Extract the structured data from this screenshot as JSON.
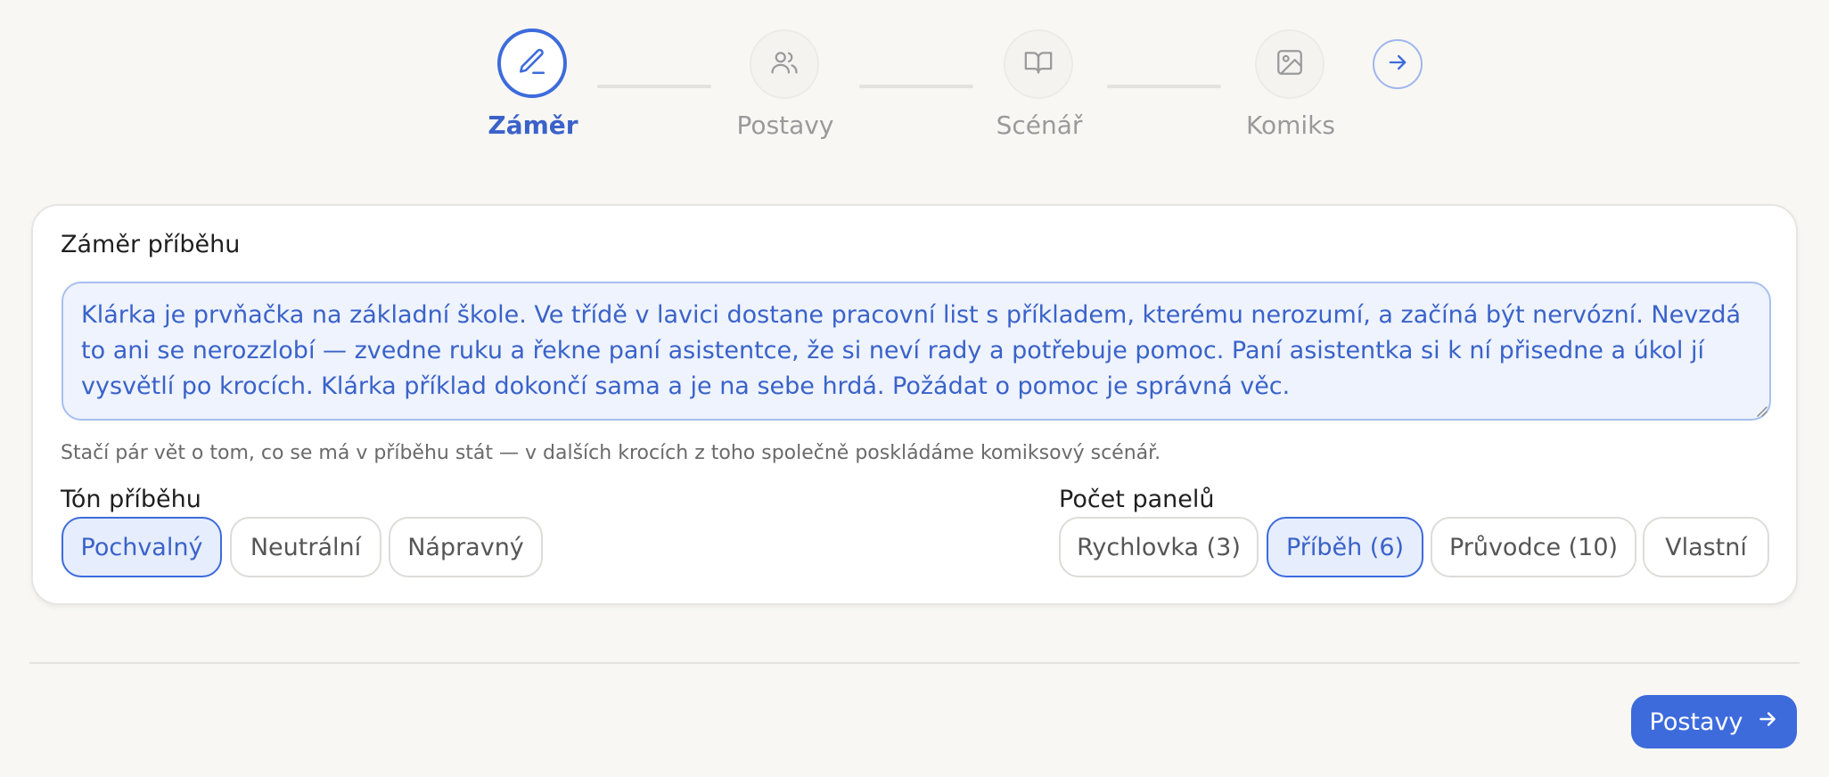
{
  "stepper": {
    "steps": [
      {
        "label": "Záměr",
        "icon": "pencil-icon",
        "active": true
      },
      {
        "label": "Postavy",
        "icon": "users-icon",
        "active": false
      },
      {
        "label": "Scénář",
        "icon": "book-icon",
        "active": false
      },
      {
        "label": "Komiks",
        "icon": "image-icon",
        "active": false
      }
    ],
    "next_icon": "arrow-right-icon"
  },
  "story": {
    "label": "Záměr příběhu",
    "text": "Klárka je prvňačka na základní škole. Ve třídě v lavici dostane pracovní list s příkladem, kterému nerozumí, a začíná být nervózní. Nevzdá to ani se nerozzlobí — zvedne ruku a řekne paní asistentce, že si neví rady a potřebuje pomoc. Paní asistentka si k ní přisedne a úkol jí vysvětlí po krocích. Klárka příklad dokončí sama a je na sebe hrdá. Požádat o pomoc je správná věc.",
    "hint": "Stačí pár vět o tom, co se má v příběhu stát — v dalších krocích z toho společně poskládáme komiksový scénář."
  },
  "tone": {
    "label": "Tón příběhu",
    "options": [
      "Pochvalný",
      "Neutrální",
      "Nápravný"
    ],
    "selected": "Pochvalný"
  },
  "panels": {
    "label": "Počet panelů",
    "options": [
      "Rychlovka (3)",
      "Příběh (6)",
      "Průvodce (10)",
      "Vlastní"
    ],
    "selected": "Příběh (6)"
  },
  "footer": {
    "next_label": "Postavy"
  },
  "colors": {
    "accent": "#3d6bdc",
    "background": "#f8f7f4",
    "selected_fill": "#e6edfc",
    "muted_text": "#9a9a9a"
  }
}
